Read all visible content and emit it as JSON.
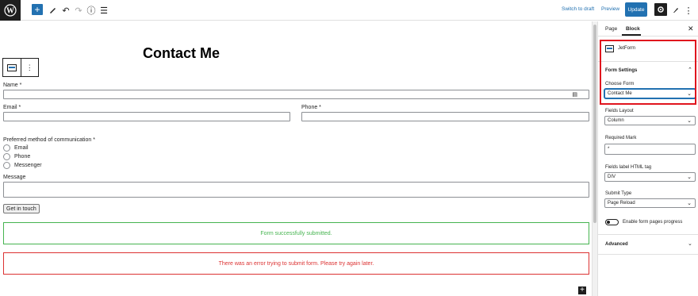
{
  "topbar": {
    "switch_to_draft": "Switch to draft",
    "preview": "Preview",
    "update": "Update"
  },
  "editor": {
    "page_title": "Contact Me",
    "form": {
      "name_label": "Name *",
      "email_label": "Email *",
      "phone_label": "Phone *",
      "preferred_label": "Preferred method of communication *",
      "options": [
        "Email",
        "Phone",
        "Messenger"
      ],
      "message_label": "Message",
      "submit_label": "Get in touch",
      "success_message": "Form successfully submitted.",
      "error_message": "There was an error trying to submit form. Please try again later."
    }
  },
  "sidebar": {
    "tabs": [
      "Page",
      "Block"
    ],
    "block_name": "JetForm",
    "form_settings_title": "Form Settings",
    "choose_form_label": "Choose Form",
    "choose_form_value": "Contact Me",
    "fields_layout_label": "Fields Layout",
    "fields_layout_value": "Column",
    "required_mark_label": "Required Mark",
    "required_mark_value": "*",
    "fields_label_tag_label": "Fields label HTML tag",
    "fields_label_tag_value": "DIV",
    "submit_type_label": "Submit Type",
    "submit_type_value": "Page Reload",
    "enable_progress_label": "Enable form pages progress",
    "advanced_label": "Advanced"
  },
  "colors": {
    "accent": "#2271b1",
    "success": "#46b450",
    "error": "#dc3232",
    "highlight": "#e0141e"
  }
}
